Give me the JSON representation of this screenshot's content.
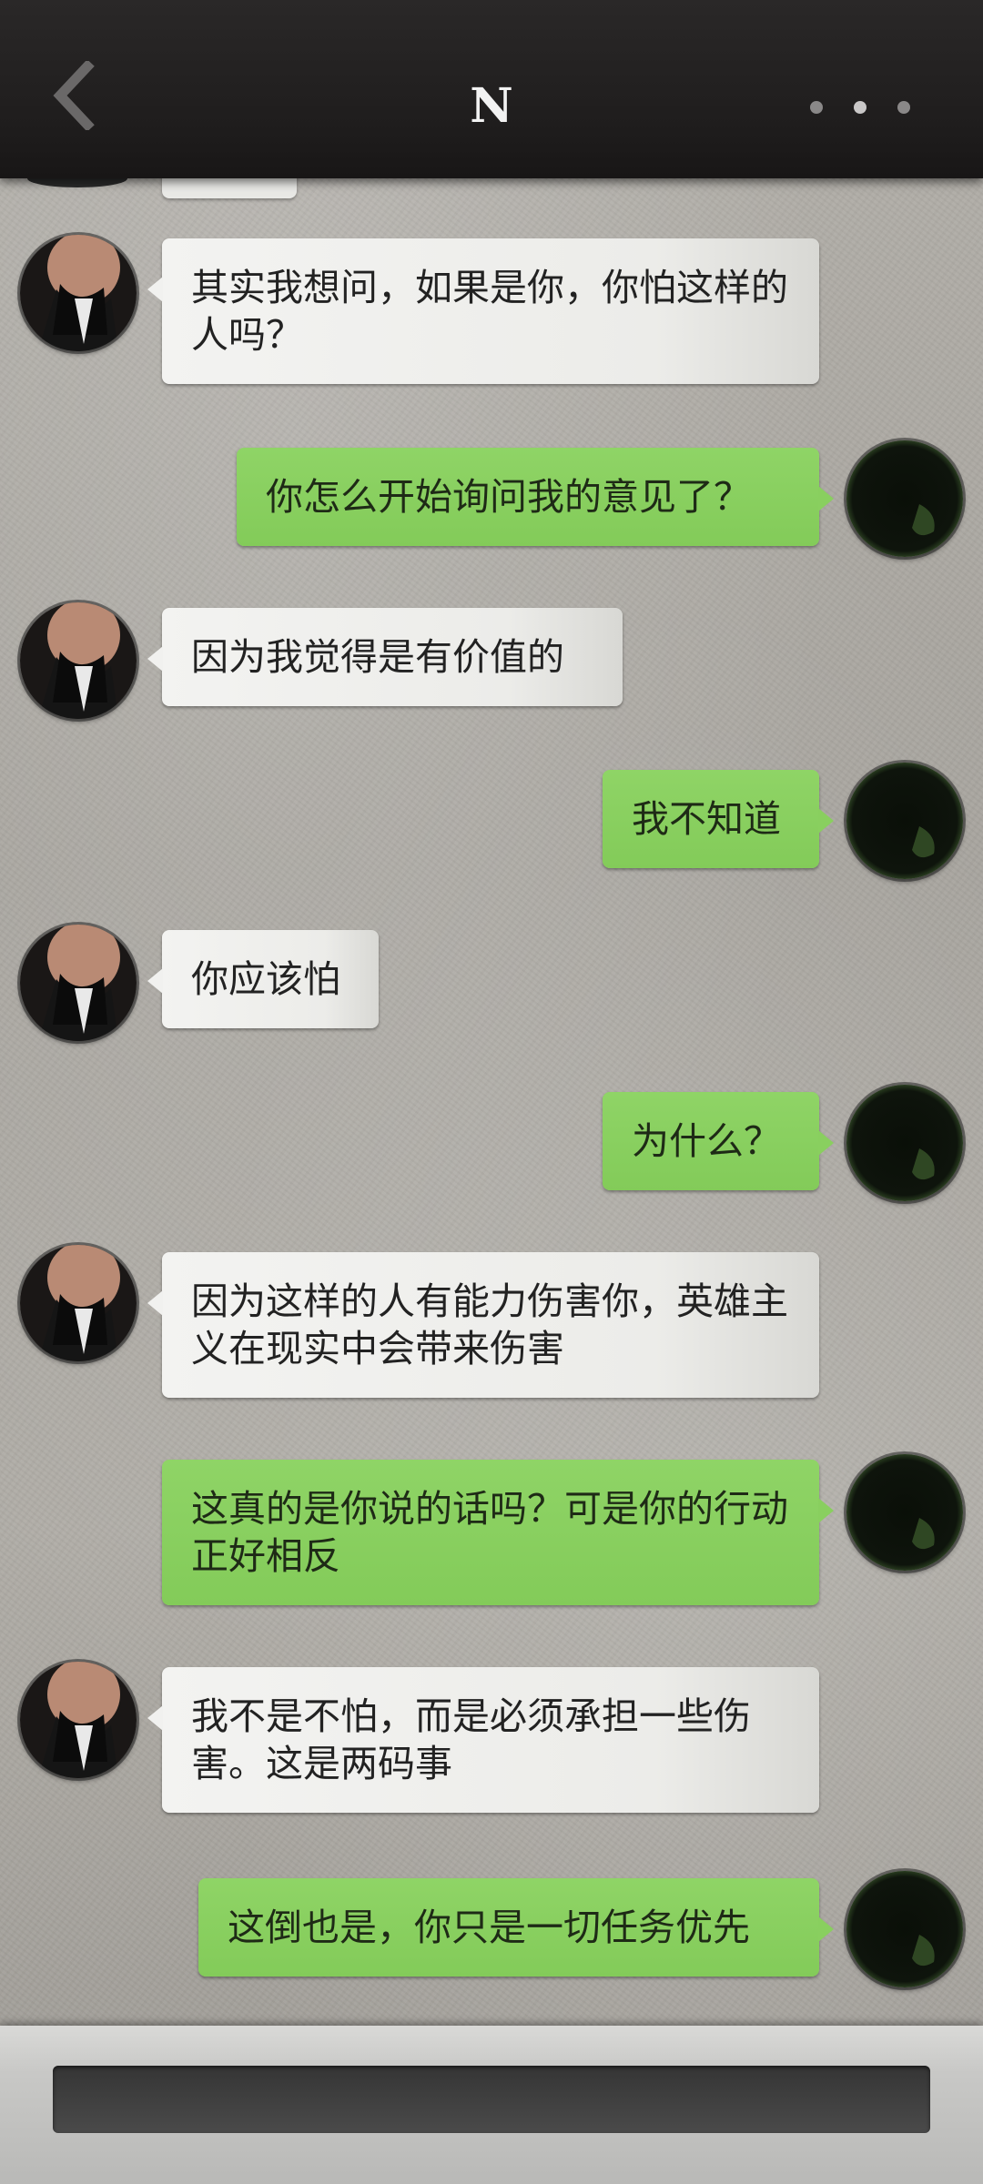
{
  "header": {
    "title": "N",
    "back_icon": "chevron-left-icon",
    "more_icon": "more-dots-icon"
  },
  "messages": [
    {
      "sender": "other",
      "text": "其实我想问，如果是你，你怕这样的人吗？"
    },
    {
      "sender": "me",
      "text": "你怎么开始询问我的意见了？"
    },
    {
      "sender": "other",
      "text": "因为我觉得是有价值的"
    },
    {
      "sender": "me",
      "text": "我不知道"
    },
    {
      "sender": "other",
      "text": "你应该怕"
    },
    {
      "sender": "me",
      "text": "为什么？"
    },
    {
      "sender": "other",
      "text": "因为这样的人有能力伤害你，英雄主义在现实中会带来伤害"
    },
    {
      "sender": "me",
      "text": "这真的是你说的话吗？可是你的行动正好相反"
    },
    {
      "sender": "other",
      "text": "我不是不怕，而是必须承担一些伤害。这是两码事"
    },
    {
      "sender": "me",
      "text": "这倒也是，你只是一切任务优先"
    }
  ],
  "colors": {
    "header_bg": "#1f1d1d",
    "bubble_other": "#f0f0ee",
    "bubble_me": "#88cf5f",
    "input_bg": "#404040"
  }
}
